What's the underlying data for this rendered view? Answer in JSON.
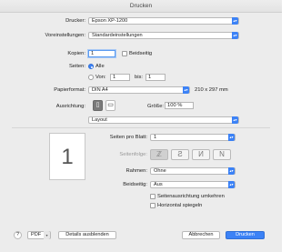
{
  "window": {
    "title": "Drucken"
  },
  "printer": {
    "label": "Drucker:",
    "value": "Epson XP-1200"
  },
  "presets": {
    "label": "Voreinstellungen:",
    "value": "Standardeinstellungen"
  },
  "copies": {
    "label": "Kopien:",
    "value": "1",
    "duplex_label": "Beidseitig"
  },
  "pages": {
    "label": "Seiten:",
    "all_label": "Alle",
    "from_label": "Von:",
    "from_value": "1",
    "to_label": "bis:",
    "to_value": "1"
  },
  "paper": {
    "label": "Papierformat:",
    "value": "DIN A4",
    "size_text": "210 x 297 mm"
  },
  "orientation": {
    "label": "Ausrichtung:",
    "scale_label": "Größe:",
    "scale_value": "100 %"
  },
  "section_menu": {
    "value": "Layout"
  },
  "preview": {
    "page_number": "1"
  },
  "layout": {
    "pages_per_sheet_label": "Seiten pro Blatt:",
    "pages_per_sheet_value": "1",
    "direction_label": "Seitenfolge:",
    "border_label": "Rahmen:",
    "border_value": "Ohne",
    "two_sided_label": "Beidseitig:",
    "two_sided_value": "Aus",
    "reverse_orientation_label": "Seitenausrichtung umkehren",
    "flip_horizontal_label": "Horizontal spiegeln"
  },
  "footer": {
    "help": "?",
    "pdf_label": "PDF",
    "details_label": "Details ausblenden",
    "cancel_label": "Abbrechen",
    "print_label": "Drucken"
  },
  "colors": {
    "accent": "#3c82f6"
  }
}
